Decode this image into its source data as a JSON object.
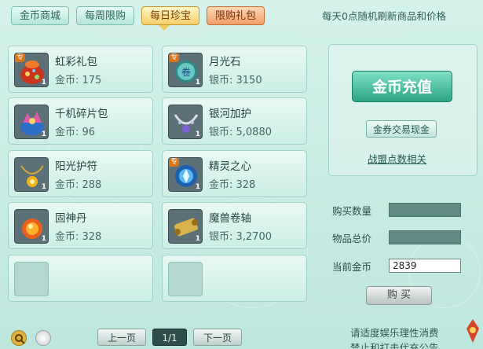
{
  "tabs": [
    {
      "label": "金币商城"
    },
    {
      "label": "每周限购"
    },
    {
      "label": "每日珍宝"
    },
    {
      "label": "限购礼包"
    }
  ],
  "notice": "每天0点随机刷新商品和价格",
  "items": [
    {
      "name": "虹彩礼包",
      "price": "金币: 175",
      "qty": "1",
      "badge": "专",
      "icon": "gift-bag-icon"
    },
    {
      "name": "月光石",
      "price": "银币: 3150",
      "qty": "1",
      "badge": "专",
      "icon": "moonstone-icon"
    },
    {
      "name": "千机碎片包",
      "price": "金币: 96",
      "qty": "1",
      "badge": "",
      "icon": "fragment-pack-icon"
    },
    {
      "name": "银河加护",
      "price": "银币: 5,0880",
      "qty": "1",
      "badge": "",
      "icon": "galaxy-necklace-icon"
    },
    {
      "name": "阳光护符",
      "price": "金币: 288",
      "qty": "1",
      "badge": "",
      "icon": "sun-amulet-icon"
    },
    {
      "name": "精灵之心",
      "price": "金币: 328",
      "qty": "1",
      "badge": "专",
      "icon": "spirit-heart-icon"
    },
    {
      "name": "固神丹",
      "price": "金币: 328",
      "qty": "1",
      "badge": "",
      "icon": "pill-icon"
    },
    {
      "name": "魔兽卷轴",
      "price": "银币: 3,2700",
      "qty": "1",
      "badge": "",
      "icon": "scroll-icon"
    }
  ],
  "pager": {
    "prev": "上一页",
    "page": "1/1",
    "next": "下一页"
  },
  "side": {
    "recharge": "金币充值",
    "trade": "金券交易现金",
    "alliance": "战盟点数相关"
  },
  "form": {
    "quantity_label": "购买数量",
    "quantity_value": "",
    "total_label": "物品总价",
    "total_value": "",
    "current_label": "当前金币",
    "current_value": "2839"
  },
  "buy_label": "购 买",
  "footer": {
    "line1": "请适度娱乐理性消费",
    "line2": "禁止和打击代充公告"
  },
  "colors": {
    "accent": "#2aa585",
    "active_tab": "#f4cf6a",
    "gift_tab": "#ef9f69"
  }
}
